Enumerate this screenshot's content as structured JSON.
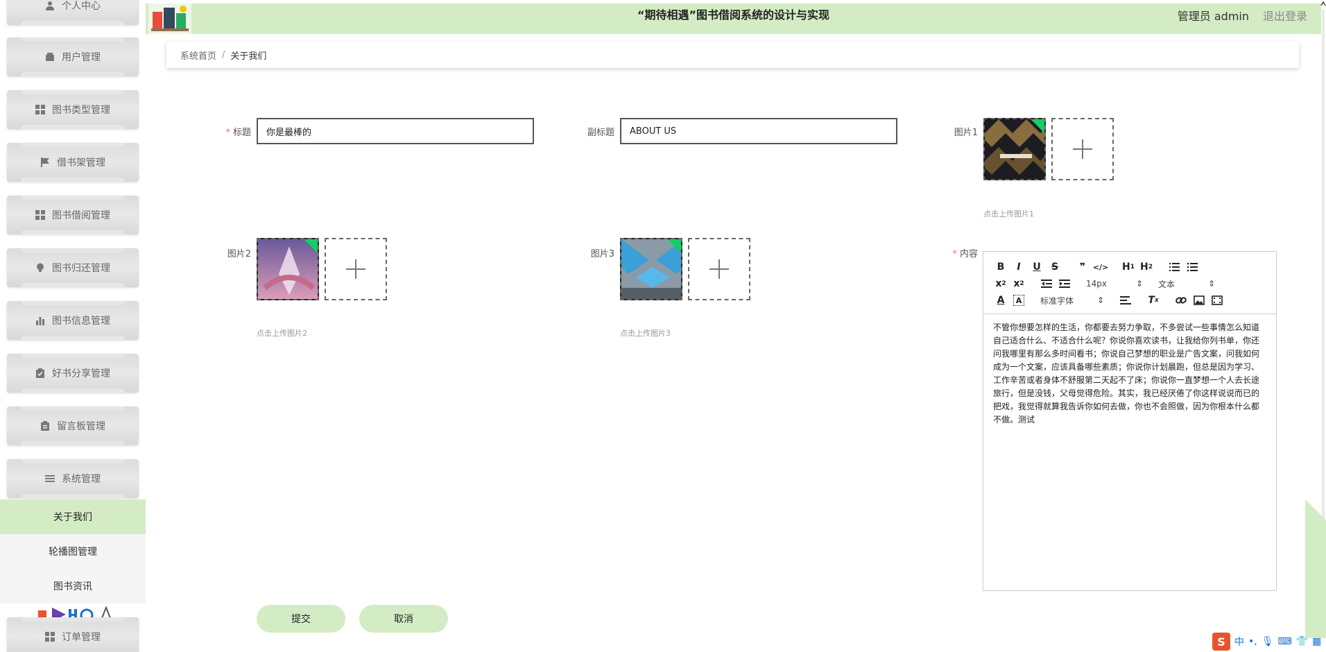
{
  "header": {
    "title": "“期待相遇”图书借阅系统的设计与实现",
    "user": "管理员 admin",
    "logout": "退出登录"
  },
  "sidebar": {
    "items": [
      {
        "label": "个人中心",
        "icon": "user-icon"
      },
      {
        "label": "用户管理",
        "icon": "wallet-icon"
      },
      {
        "label": "图书类型管理",
        "icon": "grid-icon"
      },
      {
        "label": "借书架管理",
        "icon": "flag-icon"
      },
      {
        "label": "图书借阅管理",
        "icon": "grid-icon"
      },
      {
        "label": "图书归还管理",
        "icon": "bulb-icon"
      },
      {
        "label": "图书信息管理",
        "icon": "bar-chart-icon"
      },
      {
        "label": "好书分享管理",
        "icon": "clipboard-check-icon"
      },
      {
        "label": "留言板管理",
        "icon": "clipboard-icon"
      },
      {
        "label": "系统管理",
        "icon": "menu-icon"
      },
      {
        "label": "订单管理",
        "icon": "grid-icon"
      }
    ],
    "sub_items": [
      {
        "label": "关于我们",
        "active": true
      },
      {
        "label": "轮播图管理",
        "active": false
      },
      {
        "label": "图书资讯",
        "active": false
      }
    ]
  },
  "breadcrumb": {
    "home": "系统首页",
    "separator": "/",
    "current": "关于我们"
  },
  "form": {
    "title_label": "标题",
    "title_value": "你是最棒的",
    "subtitle_label": "副标题",
    "subtitle_value": "ABOUT US",
    "image1_label": "图片1",
    "image1_hint": "点击上传图片1",
    "image2_label": "图片2",
    "image2_hint": "点击上传图片2",
    "image3_label": "图片3",
    "image3_hint": "点击上传图片3",
    "content_label": "内容"
  },
  "editor": {
    "font_size": "14px",
    "block_type": "文本",
    "font_family": "标准字体",
    "content": "不管你想要怎样的生活，你都要去努力争取，不多尝试一些事情怎么知道自己适合什么、不适合什么呢？你说你喜欢读书，让我给你列书单，你还问我哪里有那么多时间看书；你说自己梦想的职业是广告文案，问我如何成为一个文案，应该具备哪些素质；你说你计划晨跑，但总是因为学习、工作辛苦或者身体不舒服第二天起不了床；你说你一直梦想一个人去长途旅行，但是没钱，父母觉得危险。其实，我已经厌倦了你这样说说而已的把戏，我觉得就算我告诉你如何去做，你也不会照做，因为你根本什么都不做。测试"
  },
  "buttons": {
    "submit": "提交",
    "cancel": "取消"
  },
  "colors": {
    "accent": "#d4ecc4",
    "required": "#f56c6c"
  }
}
